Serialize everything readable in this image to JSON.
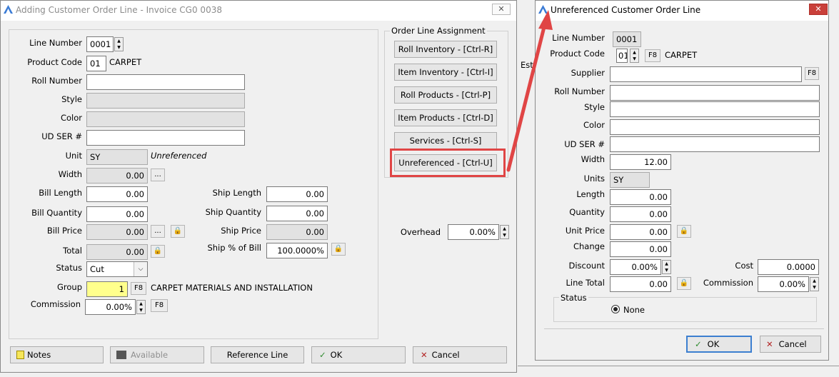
{
  "main": {
    "title": "Adding Customer Order Line - Invoice CG0 0038",
    "close": "✕",
    "line_number_label": "Line Number",
    "line_number": "0001",
    "product_code_label": "Product Code",
    "product_code": "01",
    "product_name": "CARPET",
    "roll_number_label": "Roll Number",
    "style_label": "Style",
    "color_label": "Color",
    "ud_ser_label": "UD SER #",
    "unit_label": "Unit",
    "unit": "SY",
    "unit_note": "Unreferenced",
    "width_label": "Width",
    "width": "0.00",
    "dots": "...",
    "bill_length_label": "Bill Length",
    "bill_length": "0.00",
    "bill_quantity_label": "Bill Quantity",
    "bill_quantity": "0.00",
    "bill_price_label": "Bill Price",
    "bill_price": "0.00",
    "total_label": "Total",
    "total": "0.00",
    "status_label": "Status",
    "status": "Cut",
    "group_label": "Group",
    "group": "1",
    "f8": "F8",
    "group_name": "CARPET MATERIALS AND INSTALLATION",
    "commission_label": "Commission",
    "commission": "0.00%",
    "ship_length_label": "Ship Length",
    "ship_length": "0.00",
    "ship_quantity_label": "Ship Quantity",
    "ship_quantity": "0.00",
    "ship_price_label": "Ship Price",
    "ship_price": "0.00",
    "ship_pct_label": "Ship % of Bill",
    "ship_pct": "100.0000%",
    "overhead_label": "Overhead",
    "overhead": "0.00%",
    "assign_title": "Order Line Assignment",
    "assign": [
      "Roll Inventory - [Ctrl-R]",
      "Item Inventory - [Ctrl-I]",
      "Roll Products - [Ctrl-P]",
      "Item Products - [Ctrl-D]",
      "Services - [Ctrl-S]",
      "Unreferenced - [Ctrl-U]"
    ],
    "notes": "Notes",
    "available": "Available",
    "reference": "Reference Line",
    "ok": "OK",
    "cancel": "Cancel"
  },
  "background_text": "Est",
  "dialog": {
    "title": "Unreferenced Customer Order Line",
    "line_number_label": "Line Number",
    "line_number": "0001",
    "product_code_label": "Product Code",
    "product_code": "01",
    "f8": "F8",
    "product_name": "CARPET",
    "supplier_label": "Supplier",
    "roll_number_label": "Roll Number",
    "style_label": "Style",
    "color_label": "Color",
    "ud_ser_label": "UD SER #",
    "width_label": "Width",
    "width": "12.00",
    "units_label": "Units",
    "units": "SY",
    "length_label": "Length",
    "length": "0.00",
    "quantity_label": "Quantity",
    "quantity": "0.00",
    "unit_price_label": "Unit Price",
    "unit_price": "0.00",
    "change_label": "Change",
    "change": "0.00",
    "discount_label": "Discount",
    "discount": "0.00%",
    "line_total_label": "Line Total",
    "line_total": "0.00",
    "cost_label": "Cost",
    "cost": "0.0000",
    "commission_label": "Commission",
    "commission": "0.00%",
    "status_label": "Status",
    "status_option": "None",
    "ok": "OK",
    "cancel": "Cancel",
    "close": "✕"
  },
  "colors": {
    "highlight": "#e04545",
    "yellow": "#ffff8c",
    "ok_green": "#2e8b2e",
    "cancel_red": "#b22222"
  }
}
